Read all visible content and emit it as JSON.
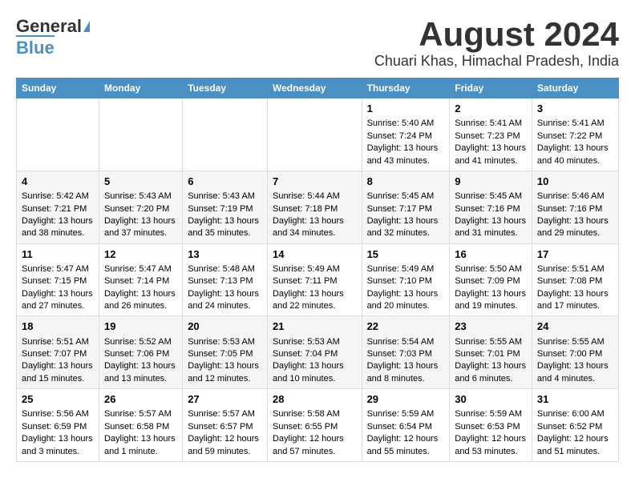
{
  "logo": {
    "line1": "General",
    "line2": "Blue"
  },
  "title": "August 2024",
  "subtitle": "Chuari Khas, Himachal Pradesh, India",
  "days_of_week": [
    "Sunday",
    "Monday",
    "Tuesday",
    "Wednesday",
    "Thursday",
    "Friday",
    "Saturday"
  ],
  "weeks": [
    [
      {
        "day": "",
        "info": ""
      },
      {
        "day": "",
        "info": ""
      },
      {
        "day": "",
        "info": ""
      },
      {
        "day": "",
        "info": ""
      },
      {
        "day": "1",
        "info": "Sunrise: 5:40 AM\nSunset: 7:24 PM\nDaylight: 13 hours and 43 minutes."
      },
      {
        "day": "2",
        "info": "Sunrise: 5:41 AM\nSunset: 7:23 PM\nDaylight: 13 hours and 41 minutes."
      },
      {
        "day": "3",
        "info": "Sunrise: 5:41 AM\nSunset: 7:22 PM\nDaylight: 13 hours and 40 minutes."
      }
    ],
    [
      {
        "day": "4",
        "info": "Sunrise: 5:42 AM\nSunset: 7:21 PM\nDaylight: 13 hours and 38 minutes."
      },
      {
        "day": "5",
        "info": "Sunrise: 5:43 AM\nSunset: 7:20 PM\nDaylight: 13 hours and 37 minutes."
      },
      {
        "day": "6",
        "info": "Sunrise: 5:43 AM\nSunset: 7:19 PM\nDaylight: 13 hours and 35 minutes."
      },
      {
        "day": "7",
        "info": "Sunrise: 5:44 AM\nSunset: 7:18 PM\nDaylight: 13 hours and 34 minutes."
      },
      {
        "day": "8",
        "info": "Sunrise: 5:45 AM\nSunset: 7:17 PM\nDaylight: 13 hours and 32 minutes."
      },
      {
        "day": "9",
        "info": "Sunrise: 5:45 AM\nSunset: 7:16 PM\nDaylight: 13 hours and 31 minutes."
      },
      {
        "day": "10",
        "info": "Sunrise: 5:46 AM\nSunset: 7:16 PM\nDaylight: 13 hours and 29 minutes."
      }
    ],
    [
      {
        "day": "11",
        "info": "Sunrise: 5:47 AM\nSunset: 7:15 PM\nDaylight: 13 hours and 27 minutes."
      },
      {
        "day": "12",
        "info": "Sunrise: 5:47 AM\nSunset: 7:14 PM\nDaylight: 13 hours and 26 minutes."
      },
      {
        "day": "13",
        "info": "Sunrise: 5:48 AM\nSunset: 7:13 PM\nDaylight: 13 hours and 24 minutes."
      },
      {
        "day": "14",
        "info": "Sunrise: 5:49 AM\nSunset: 7:11 PM\nDaylight: 13 hours and 22 minutes."
      },
      {
        "day": "15",
        "info": "Sunrise: 5:49 AM\nSunset: 7:10 PM\nDaylight: 13 hours and 20 minutes."
      },
      {
        "day": "16",
        "info": "Sunrise: 5:50 AM\nSunset: 7:09 PM\nDaylight: 13 hours and 19 minutes."
      },
      {
        "day": "17",
        "info": "Sunrise: 5:51 AM\nSunset: 7:08 PM\nDaylight: 13 hours and 17 minutes."
      }
    ],
    [
      {
        "day": "18",
        "info": "Sunrise: 5:51 AM\nSunset: 7:07 PM\nDaylight: 13 hours and 15 minutes."
      },
      {
        "day": "19",
        "info": "Sunrise: 5:52 AM\nSunset: 7:06 PM\nDaylight: 13 hours and 13 minutes."
      },
      {
        "day": "20",
        "info": "Sunrise: 5:53 AM\nSunset: 7:05 PM\nDaylight: 13 hours and 12 minutes."
      },
      {
        "day": "21",
        "info": "Sunrise: 5:53 AM\nSunset: 7:04 PM\nDaylight: 13 hours and 10 minutes."
      },
      {
        "day": "22",
        "info": "Sunrise: 5:54 AM\nSunset: 7:03 PM\nDaylight: 13 hours and 8 minutes."
      },
      {
        "day": "23",
        "info": "Sunrise: 5:55 AM\nSunset: 7:01 PM\nDaylight: 13 hours and 6 minutes."
      },
      {
        "day": "24",
        "info": "Sunrise: 5:55 AM\nSunset: 7:00 PM\nDaylight: 13 hours and 4 minutes."
      }
    ],
    [
      {
        "day": "25",
        "info": "Sunrise: 5:56 AM\nSunset: 6:59 PM\nDaylight: 13 hours and 3 minutes."
      },
      {
        "day": "26",
        "info": "Sunrise: 5:57 AM\nSunset: 6:58 PM\nDaylight: 13 hours and 1 minute."
      },
      {
        "day": "27",
        "info": "Sunrise: 5:57 AM\nSunset: 6:57 PM\nDaylight: 12 hours and 59 minutes."
      },
      {
        "day": "28",
        "info": "Sunrise: 5:58 AM\nSunset: 6:55 PM\nDaylight: 12 hours and 57 minutes."
      },
      {
        "day": "29",
        "info": "Sunrise: 5:59 AM\nSunset: 6:54 PM\nDaylight: 12 hours and 55 minutes."
      },
      {
        "day": "30",
        "info": "Sunrise: 5:59 AM\nSunset: 6:53 PM\nDaylight: 12 hours and 53 minutes."
      },
      {
        "day": "31",
        "info": "Sunrise: 6:00 AM\nSunset: 6:52 PM\nDaylight: 12 hours and 51 minutes."
      }
    ]
  ]
}
